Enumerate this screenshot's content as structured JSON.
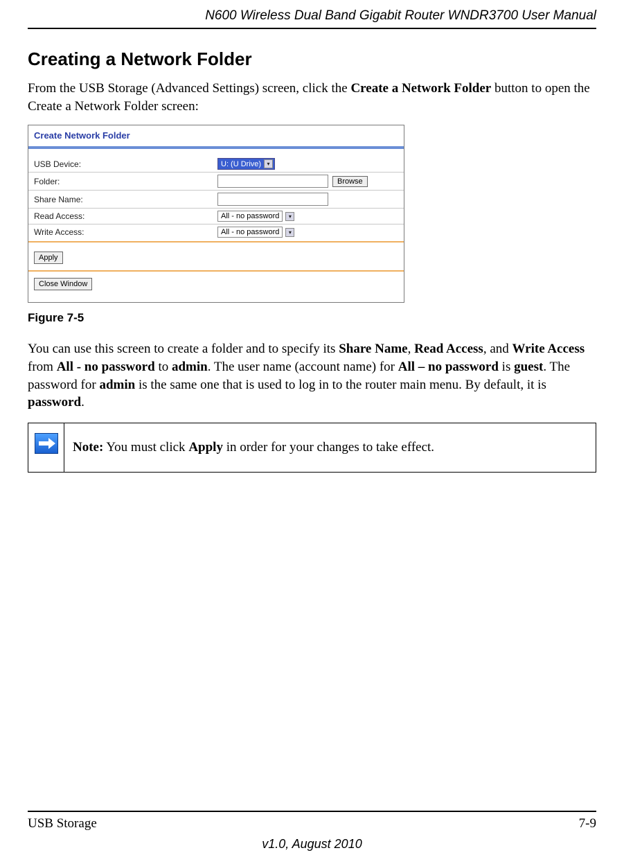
{
  "header": {
    "title": "N600 Wireless Dual Band Gigabit Router WNDR3700 User Manual"
  },
  "section": {
    "heading": "Creating a Network Folder"
  },
  "intro": {
    "pre": "From the USB Storage (Advanced Settings) screen, click the ",
    "bold": "Create a Network Folder",
    "post": " button to open the Create a Network Folder screen:"
  },
  "figure": {
    "panel_title": "Create Network Folder",
    "fields": {
      "usb_device_label": "USB Device:",
      "usb_device_value": "U: (U Drive)",
      "folder_label": "Folder:",
      "browse_label": "Browse",
      "share_name_label": "Share Name:",
      "read_access_label": "Read Access:",
      "read_access_value": "All - no password",
      "write_access_label": "Write Access:",
      "write_access_value": "All - no password"
    },
    "apply_label": "Apply",
    "close_label": "Close Window",
    "caption": "Figure 7-5"
  },
  "para2": {
    "t1": "You can use this screen to create a folder and to specify its ",
    "b1": "Share Name",
    "t2": ", ",
    "b2": "Read Access",
    "t3": ", and ",
    "b3": "Write Access",
    "t4": " from ",
    "b4": "All - no password",
    "t5": " to ",
    "b5": "admin",
    "t6": ". The user name (account name) for ",
    "b6": "All – no password",
    "t7": " is ",
    "b7": "guest",
    "t8": ". The password for ",
    "b8": "admin",
    "t9": " is the same one that is used to log in to the router main menu. By default, it is ",
    "b9": "password",
    "t10": "."
  },
  "note": {
    "bold": "Note:",
    "t1": " You must click ",
    "b1": "Apply",
    "t2": " in order for your changes to take effect."
  },
  "footer": {
    "left": "USB Storage",
    "right": "7-9",
    "version": "v1.0, August 2010"
  }
}
